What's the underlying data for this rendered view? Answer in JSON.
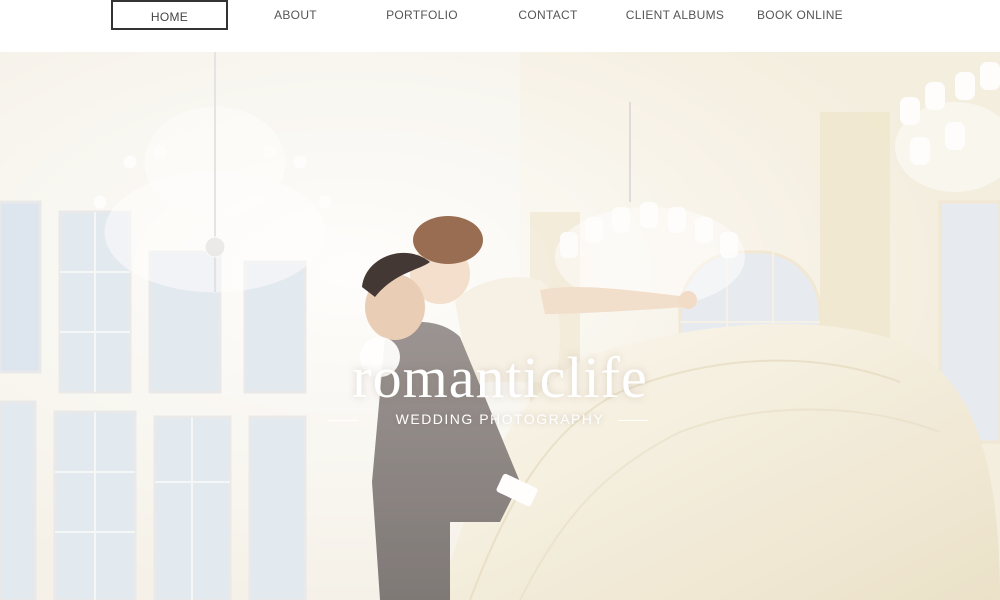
{
  "nav": {
    "items": [
      {
        "label": "HOME",
        "active": true
      },
      {
        "label": "ABOUT"
      },
      {
        "label": "PORTFOLIO"
      },
      {
        "label": "CONTACT"
      },
      {
        "label": "CLIENT ALBUMS"
      },
      {
        "label": "BOOK ONLINE"
      }
    ]
  },
  "hero": {
    "brand": "romanticlife",
    "tagline": "WEDDING PHOTOGRAPHY"
  },
  "colors": {
    "nav_text": "#555555",
    "active_border": "#333333",
    "hero_text": "#ffffff",
    "photo_tone": "#f3efe4"
  }
}
